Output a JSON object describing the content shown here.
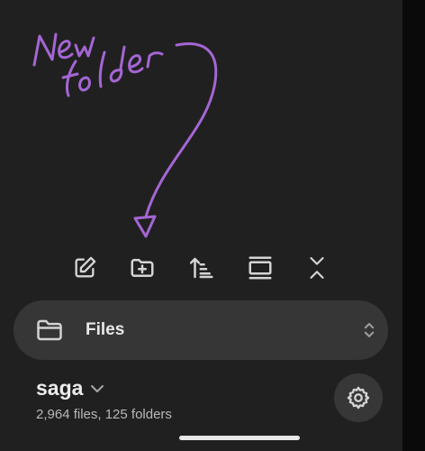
{
  "annotation": {
    "handwritten_text": "New folder",
    "color": "#a466d4"
  },
  "toolbar": {
    "buttons": [
      {
        "icon": "new-note-icon"
      },
      {
        "icon": "new-folder-icon"
      },
      {
        "icon": "sort-icon"
      },
      {
        "icon": "collapse-view-icon"
      },
      {
        "icon": "collapse-all-icon"
      }
    ]
  },
  "vault_switcher": {
    "label": "Files",
    "icon": "folder-icon",
    "toggle_icon": "chevron-up-down-icon"
  },
  "vault": {
    "name": "saga",
    "stats": "2,964 files, 125 folders"
  },
  "colors": {
    "background": "#202020",
    "surface": "#363636",
    "text": "#ececec",
    "muted_text": "#b8b8b8",
    "icon": "#d4d4d4"
  }
}
